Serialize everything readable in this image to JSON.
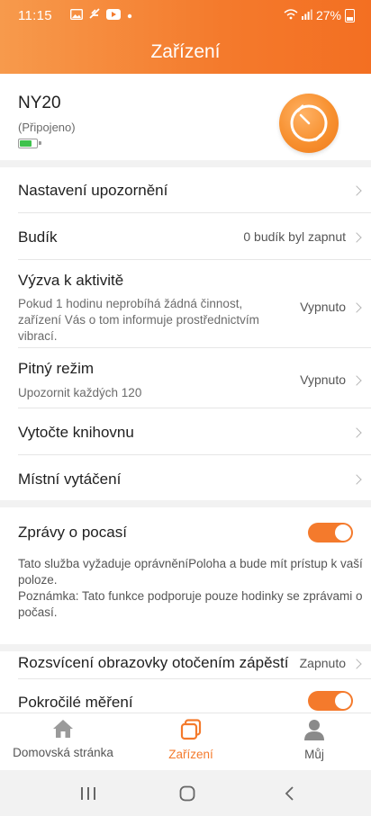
{
  "status_bar": {
    "time": "11:15",
    "battery_text": "27%",
    "icons": [
      "gallery-icon",
      "feather-icon",
      "youtube-icon",
      "dot-icon",
      "wifi-icon",
      "signal-icon",
      "battery-icon"
    ]
  },
  "header": {
    "title": "Zařízení"
  },
  "device": {
    "name": "NY20",
    "status": "(Připojeno)",
    "battery_level": 0.75
  },
  "settings": {
    "notifications": {
      "title": "Nastavení upozornění"
    },
    "alarm": {
      "title": "Budík",
      "value": "0 budík byl zapnut"
    },
    "activity": {
      "title": "Výzva k aktivitě",
      "description": "Pokud 1 hodinu neprobíhá žádná činnost, zařízení Vás o tom informuje prostřednictvím vibrací.",
      "value": "Vypnuto"
    },
    "drinking": {
      "title": "Pitný režim",
      "description": "Upozornit každých 120",
      "value": "Vypnuto"
    },
    "dial_library": {
      "title": "Vytočte knihovnu"
    },
    "local_dial": {
      "title": "Místní vytáčení"
    },
    "weather": {
      "title": "Zprávy o pocasí",
      "enabled": true,
      "description": "Tato služba vyžaduje oprávněníPoloha a bude mít prístup k vaší poloze.\nPoznámka: Tato funkce podporuje pouze hodinky se zprávami o počasí."
    },
    "wrist_wake": {
      "title": "Rozsvícení obrazovky otočením zápěstí",
      "value": "Zapnuto"
    },
    "advanced": {
      "title": "Pokročilé měření",
      "enabled": true
    }
  },
  "nav": [
    {
      "label": "Domovská stránka",
      "icon": "home-icon",
      "active": false
    },
    {
      "label": "Zařízení",
      "icon": "device-icon",
      "active": true
    },
    {
      "label": "Můj",
      "icon": "person-icon",
      "active": false
    }
  ],
  "colors": {
    "accent": "#f47a2c",
    "battery_fill": "#3fc24d"
  }
}
